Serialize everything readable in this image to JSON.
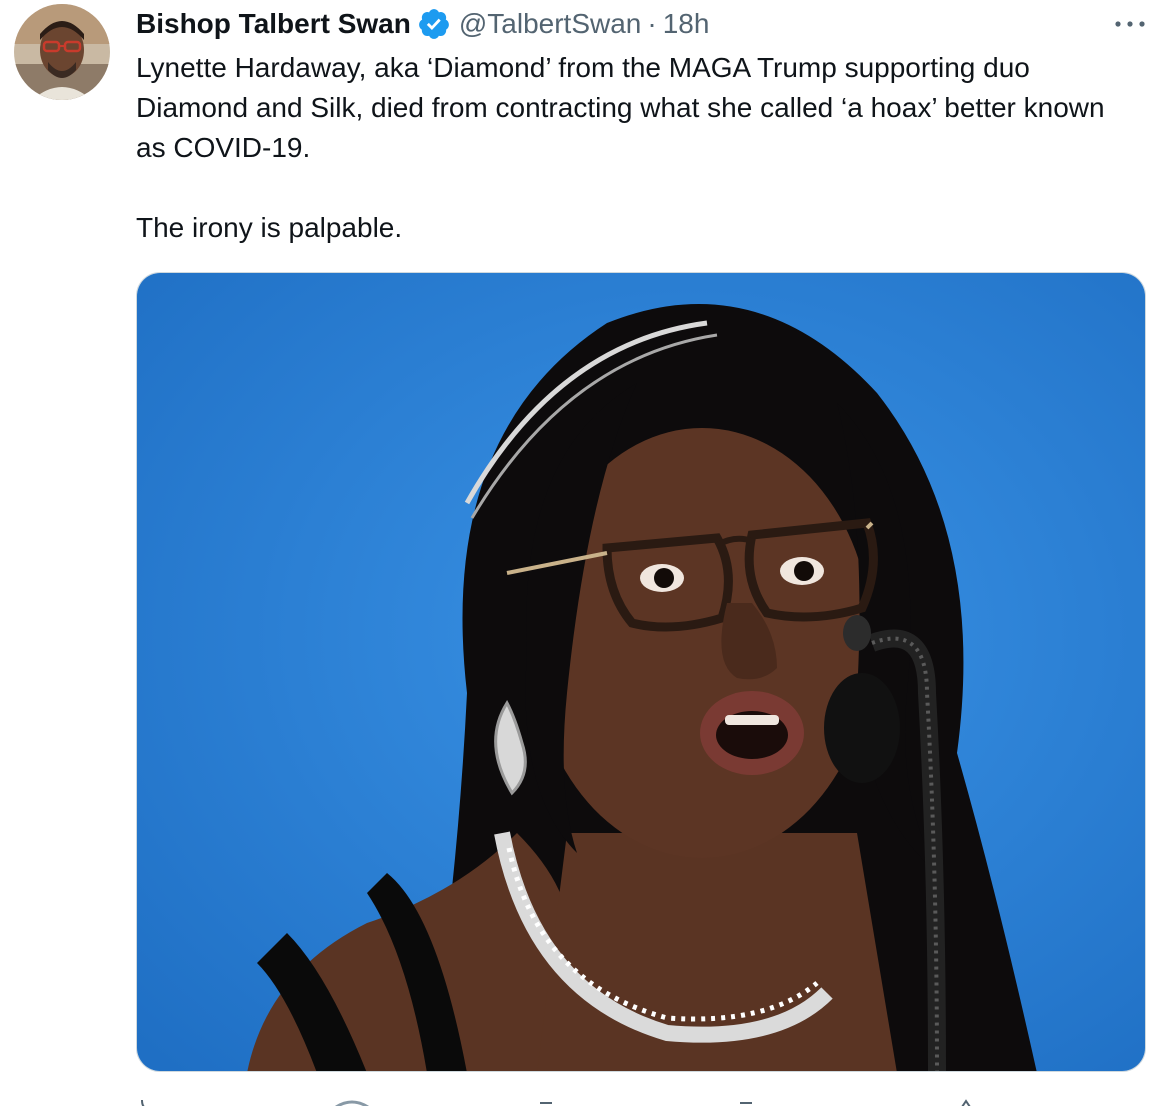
{
  "tweet": {
    "author": {
      "display_name": "Bishop Talbert Swan",
      "verified": true,
      "handle": "@TalbertSwan",
      "separator": "·",
      "time": "18h"
    },
    "text_lines": [
      "Lynette Hardaway, aka ‘Diamond’ from the MAGA Trump supporting duo Diamond and Silk, died from contracting what she called ‘a hoax’ better known as COVID-19.",
      "The irony is palpable."
    ],
    "media": {
      "type": "photo"
    },
    "colors": {
      "verified_badge": "#1d9bf0",
      "secondary_text": "#536471",
      "photo_background": "#2a7fd4"
    },
    "icons": {
      "more": "more-icon",
      "verified": "verified-badge-icon",
      "actions": [
        "reply-icon",
        "retweet-icon",
        "like-icon",
        "share-icon"
      ]
    }
  }
}
